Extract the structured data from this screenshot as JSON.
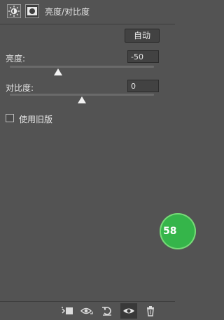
{
  "header": {
    "title": "亮度/对比度",
    "icons": [
      "adjustment-sun-icon",
      "layer-mask-icon"
    ]
  },
  "toolbar": {
    "auto_label": "自动"
  },
  "brightness": {
    "label": "亮度:",
    "value": "-50",
    "slider_fraction": 0.333
  },
  "contrast": {
    "label": "对比度:",
    "value": "0",
    "slider_fraction": 0.5
  },
  "legacy": {
    "label": "使用旧版",
    "checked": false
  },
  "badge": {
    "text": "58",
    "color": "#35b54a"
  },
  "footer": {
    "icons": [
      "clip-to-layer-icon",
      "view-previous-icon",
      "reset-icon",
      "visibility-eye-icon",
      "trash-icon"
    ]
  },
  "colors": {
    "panel_bg": "#535353",
    "field_bg": "#424242",
    "text": "#e6e6e6"
  }
}
